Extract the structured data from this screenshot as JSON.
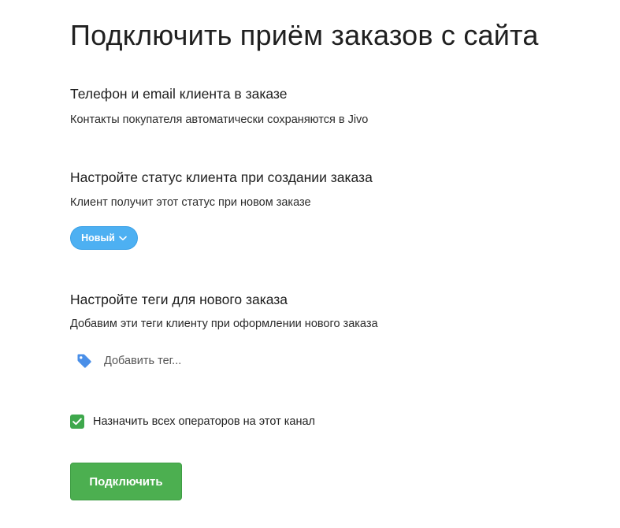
{
  "page": {
    "title": "Подключить приём заказов с сайта"
  },
  "contacts_section": {
    "heading": "Телефон и email клиента в заказе",
    "description": "Контакты покупателя автоматически сохраняются в Jivo"
  },
  "status_section": {
    "heading": "Настройте статус клиента при создании заказа",
    "description": "Клиент получит этот статус при новом заказе",
    "selected_status": "Новый",
    "dropdown_icon": "chevron-down-icon",
    "accent_color": "#4db0f2"
  },
  "tags_section": {
    "heading": "Настройте теги для нового заказа",
    "description": "Добавим эти теги клиенту при оформлении нового заказа",
    "tag_icon": "tag-icon",
    "input_placeholder": "Добавить тег...",
    "input_value": "",
    "icon_color": "#4a8fe8"
  },
  "assign": {
    "label": "Назначить всех операторов на этот канал",
    "checked": true,
    "checkbox_color": "#3ea84c"
  },
  "actions": {
    "connect_label": "Подключить",
    "connect_color": "#4caf50"
  }
}
